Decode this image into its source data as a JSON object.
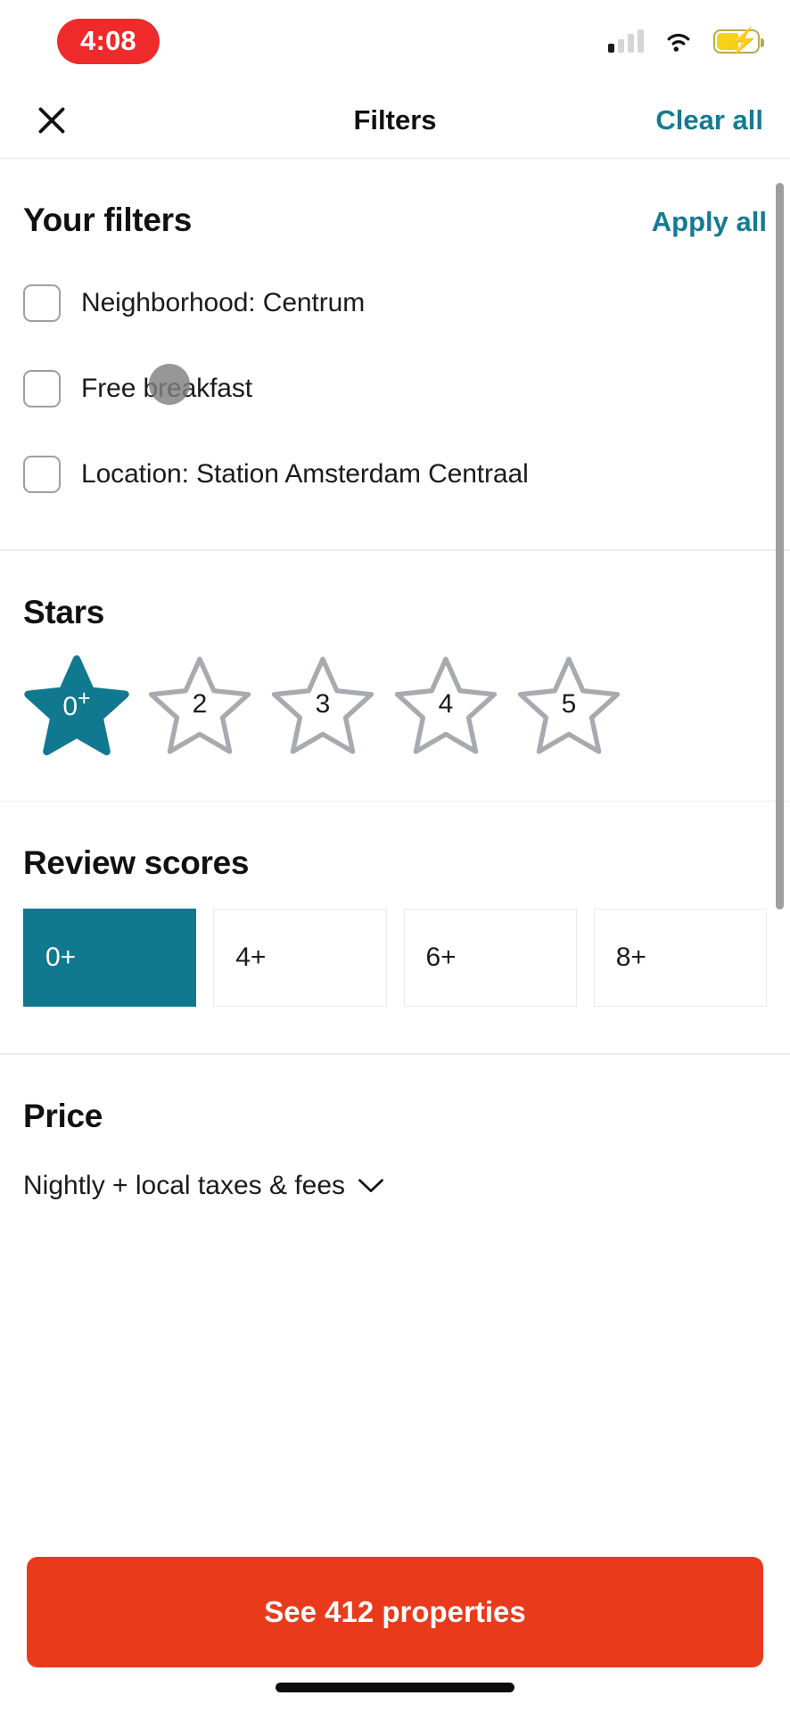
{
  "status_bar": {
    "recording_time": "4:08",
    "signal_icon": "cellular-signal-icon",
    "wifi_icon": "wifi-icon",
    "battery_icon": "battery-charging-icon"
  },
  "header": {
    "close_icon": "close-icon",
    "title": "Filters",
    "clear_all_label": "Clear all"
  },
  "your_filters": {
    "title": "Your filters",
    "apply_all_label": "Apply all",
    "items": [
      {
        "label": "Neighborhood: Centrum",
        "checked": false
      },
      {
        "label": "Free breakfast",
        "checked": false
      },
      {
        "label": "Location: Station Amsterdam Centraal",
        "checked": false
      }
    ]
  },
  "stars": {
    "title": "Stars",
    "options": [
      {
        "label": "0",
        "suffix": "+",
        "selected": true
      },
      {
        "label": "2",
        "suffix": "",
        "selected": false
      },
      {
        "label": "3",
        "suffix": "",
        "selected": false
      },
      {
        "label": "4",
        "suffix": "",
        "selected": false
      },
      {
        "label": "5",
        "suffix": "",
        "selected": false
      }
    ]
  },
  "review_scores": {
    "title": "Review scores",
    "options": [
      {
        "label": "0+",
        "selected": true
      },
      {
        "label": "4+",
        "selected": false
      },
      {
        "label": "6+",
        "selected": false
      },
      {
        "label": "8+",
        "selected": false
      }
    ]
  },
  "price": {
    "title": "Price",
    "subtitle": "Nightly + local taxes & fees",
    "chevron_icon": "chevron-down-icon"
  },
  "footer": {
    "cta_label": "See 412 properties"
  },
  "colors": {
    "accent_teal": "#10788f",
    "link_teal": "#157a92",
    "cta_orange": "#ea3a1c",
    "recording_red": "#ef2a2a"
  }
}
